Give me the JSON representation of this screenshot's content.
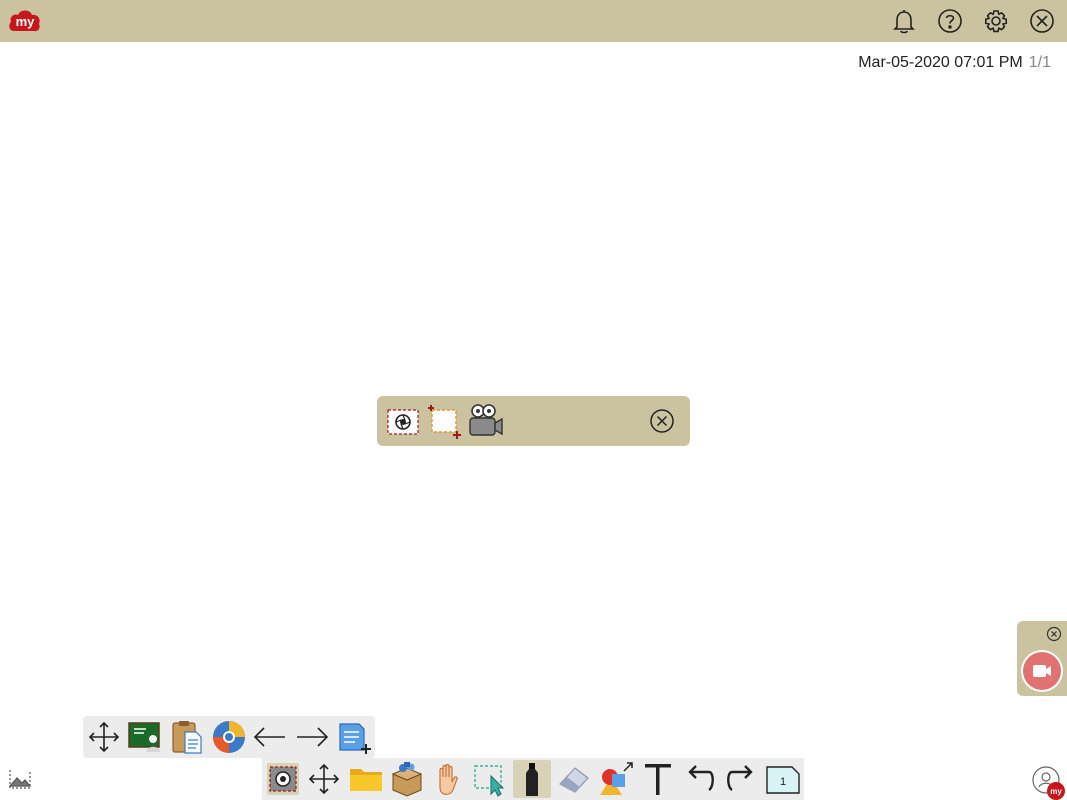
{
  "app": {
    "logo_text": "my"
  },
  "header": {
    "icons": [
      "bell-icon",
      "help-icon",
      "gear-icon",
      "close-icon"
    ]
  },
  "status": {
    "datetime": "Mar-05-2020 07:01 PM",
    "page_indicator": "1/1"
  },
  "capture_bar": {
    "tools": [
      "screenshot-icon",
      "region-add-icon",
      "video-camera-icon"
    ],
    "close": "close-icon"
  },
  "recorder": {
    "close": "close-icon",
    "record": "video-record-icon"
  },
  "toolbar_secondary": {
    "tools": [
      "move-icon",
      "classroom-board-icon",
      "clipboard-document-icon",
      "browser-icon",
      "arrow-left-icon",
      "arrow-right-icon",
      "add-page-icon"
    ]
  },
  "toolbar_main": {
    "tools": [
      "screenshot-icon",
      "move-icon",
      "folder-icon",
      "box-icon",
      "hand-icon",
      "select-icon",
      "marker-icon",
      "eraser-icon",
      "shapes-icon",
      "text-icon",
      "undo-icon",
      "redo-icon",
      "page-icon"
    ],
    "page_number": "1",
    "active_tool": "marker-icon"
  },
  "colors": {
    "accent": "#cbc3a0",
    "brand_red": "#c8161d",
    "toolbar_bg": "#ececec"
  }
}
